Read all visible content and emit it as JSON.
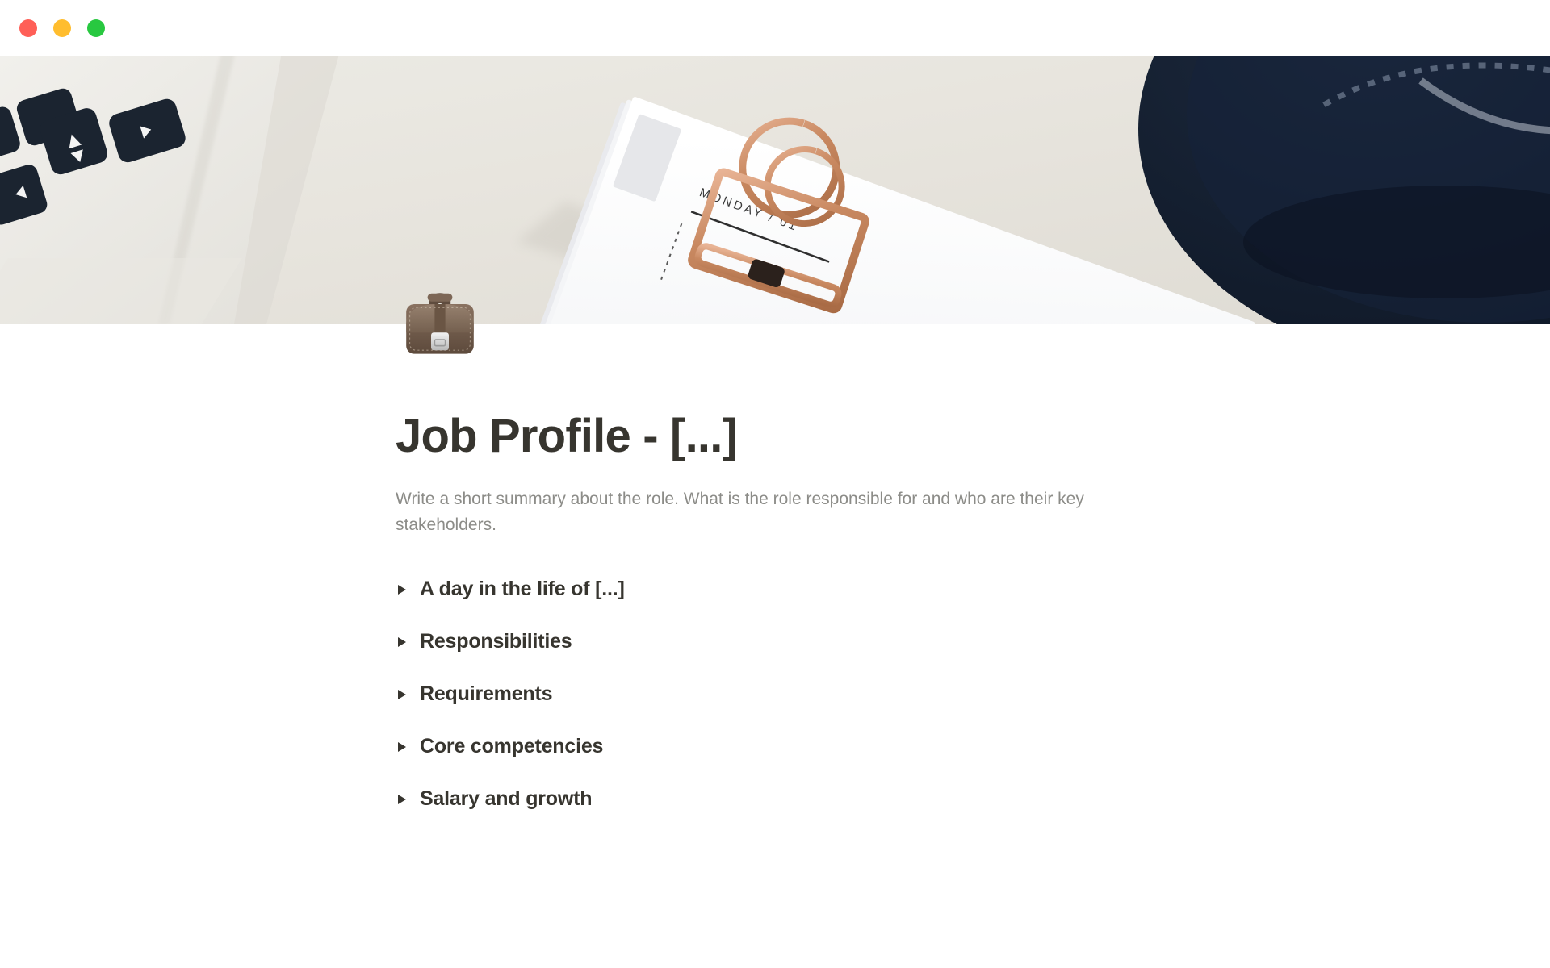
{
  "window": {
    "traffic_lights": [
      {
        "name": "close",
        "color": "#ff5f57"
      },
      {
        "name": "minimize",
        "color": "#ffbd2e"
      },
      {
        "name": "maximize",
        "color": "#28c840"
      }
    ]
  },
  "cover": {
    "alt": "Flat-lay photo of a laptop keyboard arrow keys, white papers held by a rose-gold binder clip, and a dark navy hat on a cream desk",
    "printed_text": "MONDAY / 01",
    "colors": {
      "desk": "#e8e5df",
      "paper": "#f7f7f8",
      "clip": "#cf8f6e",
      "keys": "#1b2430",
      "hat": "#111b2b"
    }
  },
  "page": {
    "icon": "briefcase-emoji",
    "title": "Job Profile - [...]",
    "description": "Write a short summary about the role. What is the role responsible for and who are their key stakeholders.",
    "toggles": [
      {
        "label": "A day in the life of [...]",
        "state": "collapsed"
      },
      {
        "label": "Responsibilities",
        "state": "collapsed"
      },
      {
        "label": "Requirements",
        "state": "collapsed"
      },
      {
        "label": "Core competencies",
        "state": "collapsed"
      },
      {
        "label": "Salary and growth",
        "state": "collapsed"
      }
    ]
  },
  "theme": {
    "text_primary": "#37352f",
    "text_muted": "#8c8c88",
    "background": "#ffffff"
  }
}
